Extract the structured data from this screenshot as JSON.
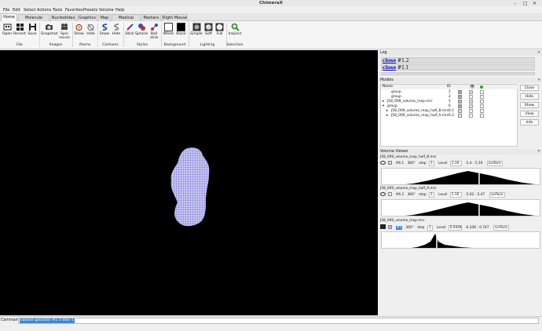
{
  "window": {
    "title": "ChimeraX"
  },
  "menu": [
    "File",
    "Edit",
    "Select",
    "Actions",
    "Tools",
    "Favorites",
    "Presets",
    "Volume",
    "Help"
  ],
  "tabs": [
    "Home",
    "Molecule Display",
    "Nucleotides",
    "Graphics",
    "Map",
    "Medical Image",
    "Markers",
    "Right Mouse"
  ],
  "toolbar": {
    "file": [
      "Open",
      "Recent",
      "Save"
    ],
    "images": [
      "Snapshot",
      "Spin movie"
    ],
    "atoms": [
      "Show",
      "Hide"
    ],
    "cartoons": [
      "Show",
      "Hide"
    ],
    "styles": [
      "Stick",
      "Sphere",
      "Ball stick"
    ],
    "background": [
      "White",
      "Black"
    ],
    "lighting": [
      "Simple",
      "Soft",
      "Full"
    ],
    "selection": [
      "Inspect"
    ],
    "groups": [
      "File",
      "Images",
      "Atoms",
      "Cartoons",
      "Styles",
      "Background",
      "Lighting",
      "Selection"
    ]
  },
  "log": {
    "title": "Log",
    "lines": [
      {
        "link": "close",
        "text": " #1.2"
      },
      {
        "link": "close",
        "text": " #1.1"
      }
    ]
  },
  "models": {
    "title": "Models",
    "headers": [
      "Name",
      "ID"
    ],
    "rows": [
      {
        "name": "group",
        "id": "1",
        "expand": ""
      },
      {
        "name": "group",
        "id": "2",
        "expand": ""
      },
      {
        "name": "J58_009_volume_map.mrc",
        "id": "5",
        "expand": "▸"
      },
      {
        "name": "group",
        "id": "6",
        "expand": "▾"
      },
      {
        "name": "J58_009_volume_map_half_B.mrc",
        "id": "6.1",
        "expand": "▸"
      },
      {
        "name": "J58_009_volume_map_half_A.mrc",
        "id": "6.2",
        "expand": "▸"
      }
    ],
    "buttons": [
      "Close",
      "Hide",
      "Show",
      "View",
      "Info"
    ]
  },
  "volume_viewer": {
    "title": "Volume Viewer",
    "maps": [
      {
        "name": "J58_009_volume_map_half_B.mrc",
        "id": "#6.1",
        "step_label": "step",
        "step": "1",
        "level_label": "Level",
        "level": "1.16",
        "range": "-5.4 - 5.19",
        "style": "surface"
      },
      {
        "name": "J58_009_volume_map_half_A.mrc",
        "id": "#6.2",
        "step_label": "step",
        "step": "1",
        "level_label": "Level",
        "level": "1.16",
        "range": "-5.62 - 5.47",
        "style": "surface"
      },
      {
        "name": "J58_009_volume_map.mrc",
        "id": "#5",
        "step_label": "step",
        "step": "1",
        "level_label": "Level",
        "level": "0.0444",
        "range": "-0.346 - 0.747",
        "style": "surface"
      }
    ]
  },
  "command": {
    "label": "Command:",
    "value": "volume gaussian #1.1 sdev 1"
  },
  "colors": {
    "accent": "#3a88d8",
    "map_surface": "#b4b4f0",
    "viewport_bg": "#000000",
    "link": "#0000cc"
  }
}
